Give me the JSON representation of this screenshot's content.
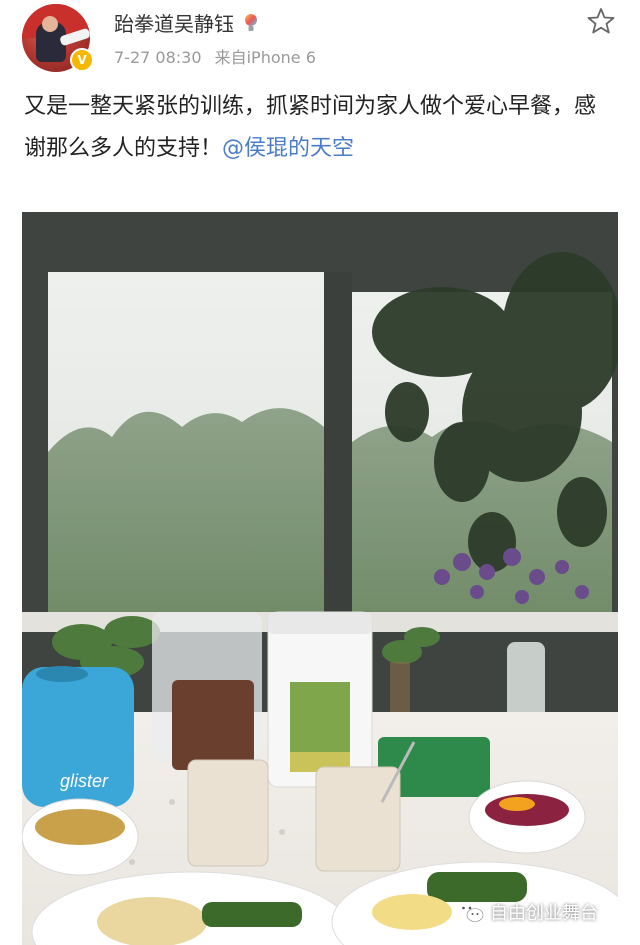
{
  "post": {
    "author_name": "跆拳道吴静钰",
    "time": "7-27 08:30",
    "source": "来自iPhone 6",
    "text": "又是一整天紧张的训练，抓紧时间为家人做个爱心早餐，感谢那么多人的支持！",
    "mention": "@侯琨的天空",
    "verified_badge": "V",
    "icons": [
      "bulb-icon",
      "star-icon"
    ]
  },
  "photo": {
    "product_label": "glister"
  },
  "watermark": {
    "text": "自由创业舞台",
    "icon": "wechat-icon"
  }
}
